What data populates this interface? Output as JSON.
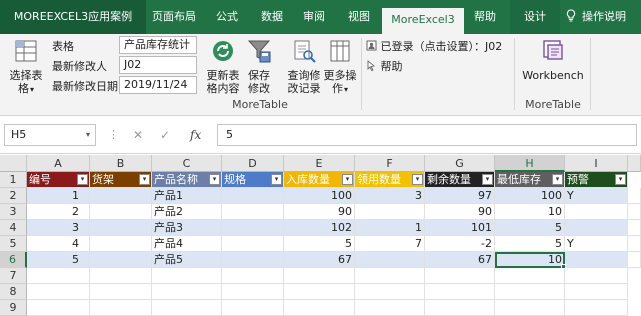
{
  "tabs": {
    "file": "MOREEXCEL3应用案例",
    "page_layout": "页面布局",
    "formulas": "公式",
    "data": "数据",
    "review": "审阅",
    "view": "视图",
    "moreexcel": "MoreExcel3",
    "help": "帮助",
    "design": "设计",
    "tell_me": "操作说明"
  },
  "ribbon": {
    "select_table": "选择表格",
    "select_table_arrow": "▾",
    "table_label": "表格",
    "table_value": "产品库存统计",
    "modifier_label": "最新修改人",
    "modifier_value": "J02",
    "modified_date_label": "最新修改日期",
    "modified_date_value": "2019/11/24",
    "update_content": "更新表格内容",
    "save_changes": "保存修改",
    "query_log": "查询修改记录",
    "more_ops": "更多操作",
    "more_ops_arrow": "▾",
    "group_moretable": "MoreTable",
    "login_status": "已登录（点击设置）：J02",
    "help": "帮助",
    "workbench": "Workbench",
    "group_moretable2": "MoreTable"
  },
  "formula_bar": {
    "name_box": "H5",
    "name_box_arrow": "▾",
    "cancel_icon": "✕",
    "confirm_icon": "✓",
    "fx": "fx",
    "value": "5"
  },
  "grid": {
    "columns": [
      "A",
      "B",
      "C",
      "D",
      "E",
      "F",
      "G",
      "H",
      "I"
    ],
    "row_numbers": [
      "1",
      "2",
      "3",
      "4",
      "5",
      "6",
      "7",
      "8",
      "9"
    ],
    "header_row": [
      "编号",
      "货架",
      "产品名称",
      "规格",
      "入库数量",
      "领用数量",
      "剩余数量",
      "最低库存",
      "预警"
    ],
    "filter_glyph": "▾",
    "rows": [
      [
        "1",
        "",
        "产品1",
        "",
        "100",
        "3",
        "97",
        "100",
        "Y"
      ],
      [
        "2",
        "",
        "产品2",
        "",
        "90",
        "",
        "90",
        "10",
        ""
      ],
      [
        "3",
        "",
        "产品3",
        "",
        "102",
        "1",
        "101",
        "5",
        ""
      ],
      [
        "4",
        "",
        "产品4",
        "",
        "5",
        "7",
        "-2",
        "5",
        "Y"
      ],
      [
        "5",
        "",
        "产品5",
        "",
        "67",
        "",
        "67",
        "10",
        ""
      ]
    ],
    "active_cell": "H5",
    "header_colors": {
      "A": "#8b1a1a",
      "B": "#7b3f00",
      "C": "#6b7fa8",
      "D": "#4e7cc8",
      "E": "#f2b705",
      "F": "#f2c200",
      "G": "#222222",
      "H": "#5f5f5f",
      "I": "#1e4d1e"
    }
  },
  "colors": {
    "accent": "#217346",
    "band": "#dbe5f3"
  }
}
